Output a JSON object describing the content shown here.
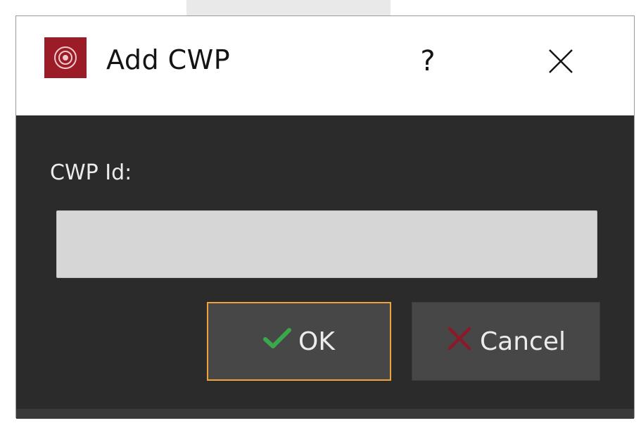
{
  "dialog": {
    "title": "Add CWP",
    "help_label": "?",
    "app_icon": "app-logo-icon",
    "close_icon": "close-icon"
  },
  "form": {
    "cwp_id_label": "CWP Id:",
    "cwp_id_value": "",
    "cwp_id_placeholder": ""
  },
  "buttons": {
    "ok_label": "OK",
    "ok_icon": "checkmark-icon",
    "cancel_label": "Cancel",
    "cancel_icon": "x-icon"
  },
  "colors": {
    "accent_focus": "#f0a23c",
    "app_icon_bg": "#9b1c27",
    "ok_check": "#3aa84a",
    "cancel_x": "#8a1a2a",
    "dialog_body": "#2b2b2b"
  }
}
